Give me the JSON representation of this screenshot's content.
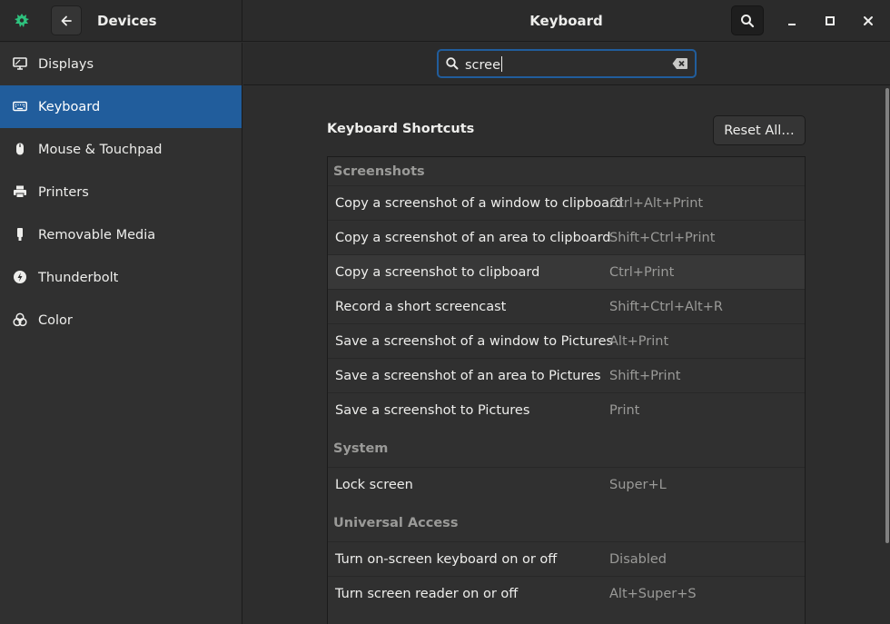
{
  "header": {
    "panel_title": "Devices",
    "title": "Keyboard"
  },
  "sidebar": {
    "items": [
      {
        "label": "Displays",
        "icon": "display-icon"
      },
      {
        "label": "Keyboard",
        "icon": "keyboard-icon",
        "active": true
      },
      {
        "label": "Mouse & Touchpad",
        "icon": "mouse-icon"
      },
      {
        "label": "Printers",
        "icon": "printer-icon"
      },
      {
        "label": "Removable Media",
        "icon": "usb-drive-icon"
      },
      {
        "label": "Thunderbolt",
        "icon": "thunderbolt-icon"
      },
      {
        "label": "Color",
        "icon": "color-icon"
      }
    ]
  },
  "search": {
    "value": "scree"
  },
  "shortcuts": {
    "title": "Keyboard Shortcuts",
    "reset_label": "Reset All…",
    "groups": [
      {
        "name": "Screenshots",
        "rows": [
          {
            "desc": "Copy a screenshot of a window to clipboard",
            "accel": "Ctrl+Alt+Print"
          },
          {
            "desc": "Copy a screenshot of an area to clipboard",
            "accel": "Shift+Ctrl+Print"
          },
          {
            "desc": "Copy a screenshot to clipboard",
            "accel": "Ctrl+Print"
          },
          {
            "desc": "Record a short screencast",
            "accel": "Shift+Ctrl+Alt+R"
          },
          {
            "desc": "Save a screenshot of a window to Pictures",
            "accel": "Alt+Print"
          },
          {
            "desc": "Save a screenshot of an area to Pictures",
            "accel": "Shift+Print"
          },
          {
            "desc": "Save a screenshot to Pictures",
            "accel": "Print"
          }
        ]
      },
      {
        "name": "System",
        "rows": [
          {
            "desc": "Lock screen",
            "accel": "Super+L"
          }
        ]
      },
      {
        "name": "Universal Access",
        "rows": [
          {
            "desc": "Turn on-screen keyboard on or off",
            "accel": "Disabled"
          },
          {
            "desc": "Turn screen reader on or off",
            "accel": "Alt+Super+S"
          }
        ]
      }
    ]
  },
  "colors": {
    "accent": "#215d9c",
    "app_icon": "#2ec27e"
  }
}
